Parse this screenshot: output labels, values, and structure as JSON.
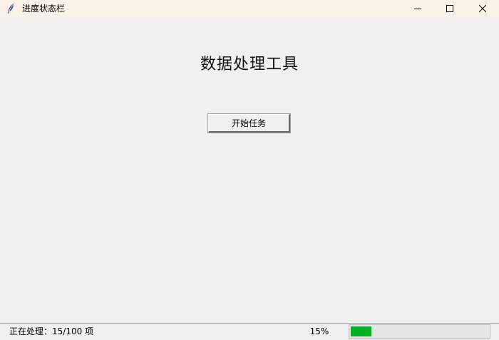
{
  "window": {
    "title": "进度状态栏"
  },
  "main": {
    "title": "数据处理工具",
    "start_button_label": "开始任务"
  },
  "statusbar": {
    "status_text": "正在处理：15/100 项",
    "percent_label": "15%",
    "progress_fraction": 0.15
  },
  "icons": {
    "app": "feather-icon",
    "minimize": "minimize-icon",
    "maximize": "maximize-icon",
    "close": "close-icon"
  },
  "colors": {
    "titlebar_bg": "#fbf1e7",
    "window_bg": "#f0f0f0",
    "progress_fill": "#06b025"
  }
}
